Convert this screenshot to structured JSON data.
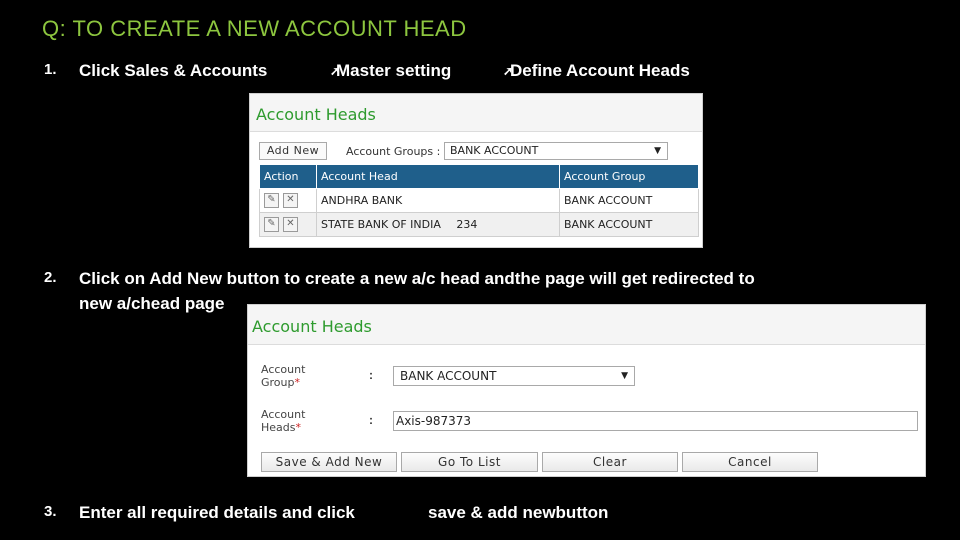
{
  "title": "Q: TO CREATE A NEW ACCOUNT HEAD",
  "steps": [
    {
      "num": "1.",
      "text": "Click  Sales & Accounts        Master setting        Define Account  Heads"
    },
    {
      "num": "2.",
      "line1": "Click  on Add New button to create a new a/c  head andthe page will get redirected to",
      "line2": "new a/chead page"
    },
    {
      "num": "3.",
      "text_a": "Enter all required details and click",
      "text_b": "save & add newbutton"
    }
  ],
  "step1_parts": {
    "a": "Click  Sales & Accounts",
    "arrow1": "➚",
    "b": "Master setting",
    "arrow2": "➚",
    "c": "Define Account  Heads"
  },
  "screen1": {
    "heading": "Account Heads",
    "add_new": "Add New",
    "groups_label": "Account Groups :",
    "groups_value": "BANK ACCOUNT",
    "columns": [
      "Action",
      "Account Head",
      "Account Group"
    ],
    "rows": [
      {
        "head": "ANDHRA BANK",
        "extra": "",
        "group": "BANK ACCOUNT"
      },
      {
        "head": "STATE BANK OF INDIA",
        "extra": "234",
        "group": "BANK ACCOUNT"
      }
    ]
  },
  "screen2": {
    "heading": "Account Heads",
    "group_label_1": "Account",
    "group_label_2": "Group",
    "heads_label_1": "Account",
    "heads_label_2": "Heads",
    "required_mark": "*",
    "colon": ":",
    "group_value": "BANK ACCOUNT",
    "heads_value": "Axis-987373",
    "buttons": {
      "save_add": "Save & Add New",
      "go_to_list": "Go To List",
      "clear": "Clear",
      "cancel": "Cancel"
    }
  },
  "colors": {
    "title": "#8dc63f",
    "header_green": "#2e9b2e",
    "table_header": "#1f5f8b",
    "background": "#000000"
  }
}
